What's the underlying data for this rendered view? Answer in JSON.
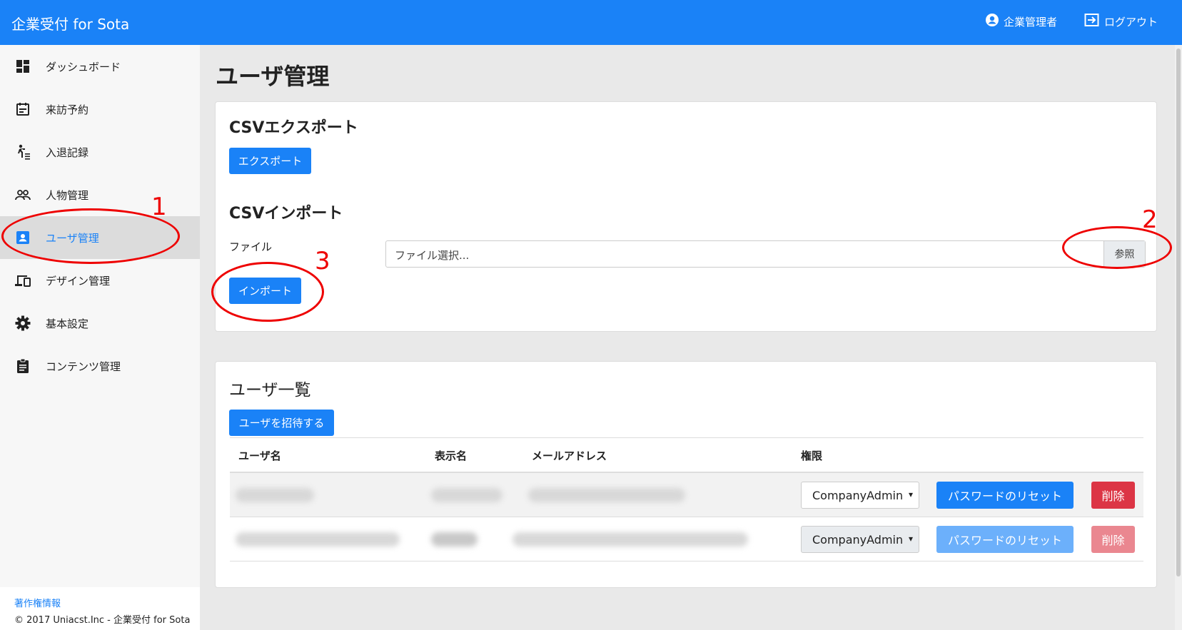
{
  "app": {
    "title": "企業受付 for Sota"
  },
  "header": {
    "user_label": "企業管理者",
    "logout_label": "ログアウト"
  },
  "sidebar": {
    "items": [
      {
        "label": "ダッシュボード",
        "icon": "dashboard-icon"
      },
      {
        "label": "来訪予約",
        "icon": "calendar-icon"
      },
      {
        "label": "入退記録",
        "icon": "walk-log-icon"
      },
      {
        "label": "人物管理",
        "icon": "people-icon"
      },
      {
        "label": "ユーザ管理",
        "icon": "user-badge-icon",
        "active": true
      },
      {
        "label": "デザイン管理",
        "icon": "devices-icon"
      },
      {
        "label": "基本設定",
        "icon": "gear-icon"
      },
      {
        "label": "コンテンツ管理",
        "icon": "clipboard-icon"
      }
    ],
    "footer": {
      "link": "著作権情報",
      "copyright": "© 2017 Uniacst.Inc - 企業受付 for Sota"
    }
  },
  "main": {
    "title": "ユーザ管理",
    "csv_export": {
      "heading": "CSVエクスポート",
      "button": "エクスポート"
    },
    "csv_import": {
      "heading": "CSVインポート",
      "file_label": "ファイル",
      "file_placeholder": "ファイル選択...",
      "browse_label": "参照",
      "button": "インポート"
    },
    "user_list": {
      "heading": "ユーザ一覧",
      "invite_button": "ユーザを招待する",
      "columns": [
        "ユーザ名",
        "表示名",
        "メールアドレス",
        "権限"
      ],
      "rows": [
        {
          "role": "CompanyAdmin",
          "reset_label": "パスワードのリセット",
          "delete_label": "削除",
          "enabled": true
        },
        {
          "role": "CompanyAdmin",
          "reset_label": "パスワードのリセット",
          "delete_label": "削除",
          "enabled": false
        }
      ]
    }
  },
  "annotations": [
    "1",
    "2",
    "3"
  ],
  "colors": {
    "primary": "#1a82f7",
    "danger": "#dc3545",
    "annotation": "#e00000"
  }
}
